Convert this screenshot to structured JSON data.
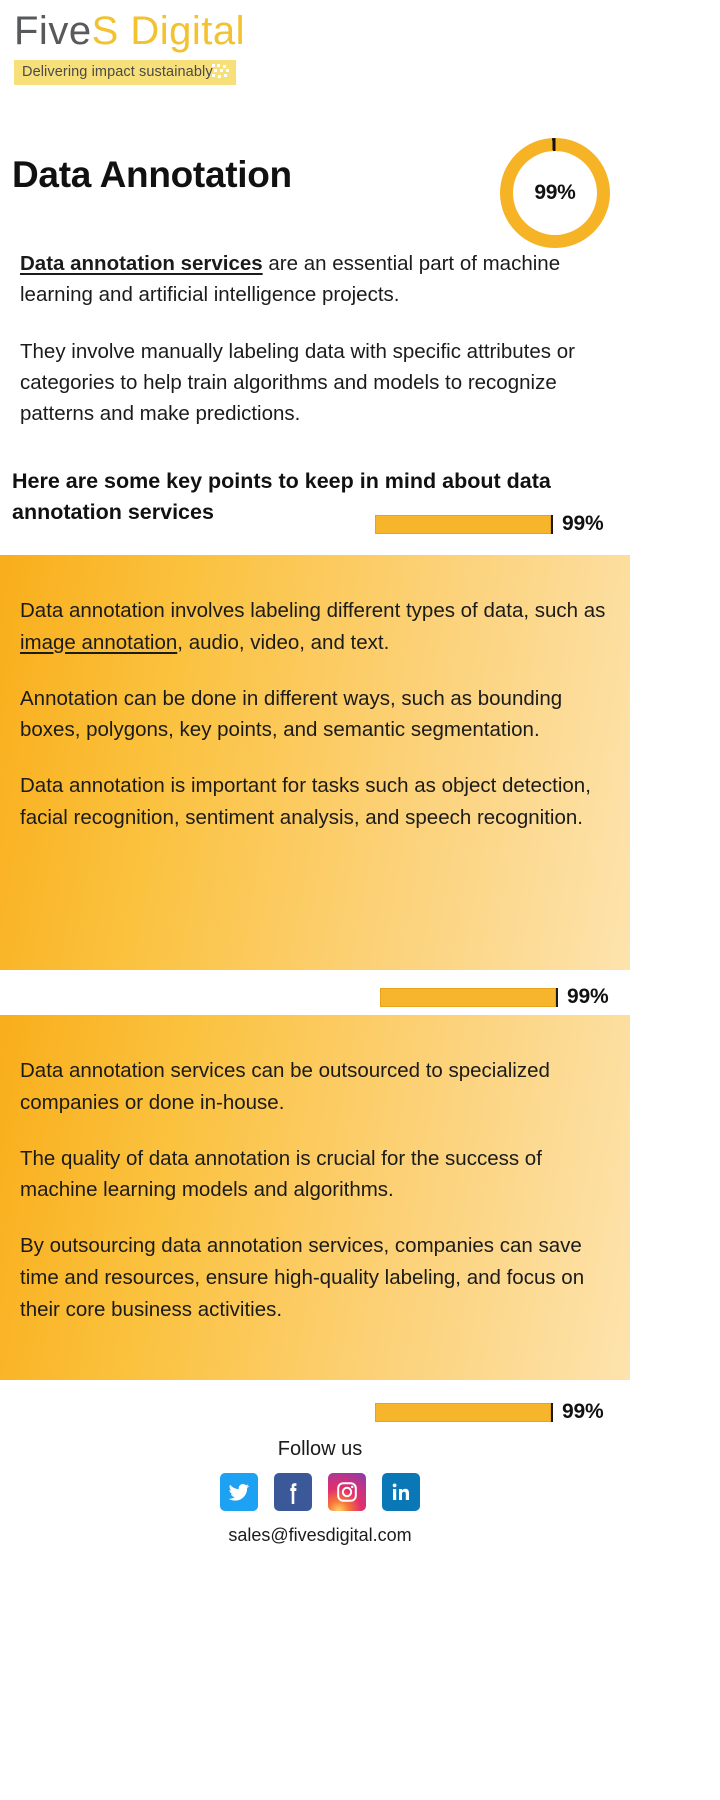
{
  "brand": {
    "name_part1": "Five",
    "name_part2": "S",
    "name_part3": " Digital",
    "tagline": "Delivering impact sustainably"
  },
  "header": {
    "title": "Data Annotation",
    "donut_percent": "99%",
    "donut_value": 99
  },
  "intro": {
    "lead": "Data annotation services",
    "lead_rest": " are an essential part of machine learning and artificial intelligence projects.",
    "paragraph2": "They involve manually labeling data with specific attributes or categories to help train algorithms and models to recognize patterns and make predictions."
  },
  "sub_heading": "Here are some key points to keep in mind about data annotation services",
  "bars": [
    {
      "label": "99%",
      "value": 99
    },
    {
      "label": "99%",
      "value": 99
    },
    {
      "label": "99%",
      "value": 99
    }
  ],
  "panel1": {
    "p1_a": "Data annotation involves labeling different types of data, such as ",
    "p1_link": "image annotation",
    "p1_b": ", audio, video, and text.",
    "p2": "Annotation can be done in different ways, such as bounding boxes, polygons, key points, and semantic segmentation.",
    "p3": "Data annotation is important for tasks such as object detection, facial recognition, sentiment analysis, and speech recognition."
  },
  "panel2": {
    "p1": "Data annotation services can be outsourced to specialized companies or done in-house.",
    "p2": "The quality of data annotation is crucial for the success of machine learning models and algorithms.",
    "p3": "By outsourcing data annotation services, companies can save time and resources, ensure high-quality labeling, and focus on their core business activities."
  },
  "footer": {
    "follow_us": "Follow us",
    "email": "sales@fivesdigital.com",
    "socials": [
      {
        "name": "twitter",
        "color": "#1da1f2"
      },
      {
        "name": "facebook",
        "color": "#3b5998"
      },
      {
        "name": "instagram",
        "color": "#e1306c"
      },
      {
        "name": "linkedin",
        "color": "#0a78b6"
      }
    ]
  },
  "colors": {
    "brand_yellow": "#f2c230",
    "bar_orange": "#f7b52c",
    "panel_start": "#f9ae1b",
    "panel_end": "#fde3ad",
    "text": "#1b1b1b"
  }
}
